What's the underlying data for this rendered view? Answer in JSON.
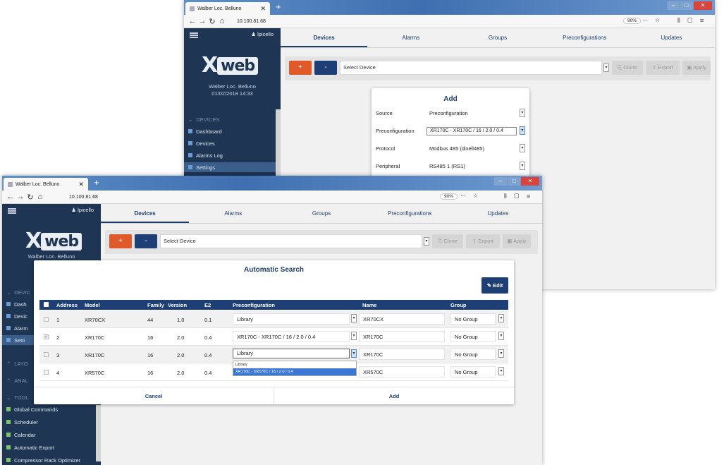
{
  "back_window": {
    "tab_title": "Walber Loc. Belluno",
    "url": "10.100.81.68",
    "zoom": "90%",
    "user": "lpicello",
    "logo": "web",
    "site_name": "Walber Loc. Belluno",
    "site_datetime": "01/02/2018 14:33",
    "sidebar_section": "DEVICES",
    "sidebar_items": [
      "Dashboard",
      "Devices",
      "Alarms Log",
      "Settings"
    ],
    "tabs": [
      "Devices",
      "Alarms",
      "Groups",
      "Preconfigurations",
      "Updates"
    ],
    "plus_label": "+",
    "minus_label": "-",
    "select_device": "Select Device",
    "clone_label": "Clone",
    "export_label": "Export",
    "apply_label": "Apply",
    "add_dialog": {
      "title": "Add",
      "rows": [
        {
          "label": "Source",
          "value": "Preconfiguration"
        },
        {
          "label": "Preconfiguration",
          "value": "XR170C - XR170C / 16 / 2.0 / 0.4"
        },
        {
          "label": "Protocol",
          "value": "Modbus 485 (dixell485)"
        },
        {
          "label": "Peripheral",
          "value": "RS485 1 (RS1)"
        }
      ]
    }
  },
  "front_window": {
    "tab_title": "Walber Loc. Belluno",
    "url": "10.100.81.68",
    "zoom": "90%",
    "user": "lpicello",
    "logo": "web",
    "site_name": "Walber Loc. Belluno",
    "sidebar_partial": [
      "DEVIC",
      "Dash",
      "Devic",
      "Alarm",
      "Setti",
      "LAYO",
      "ANAL",
      "TOOL"
    ],
    "sidebar_tools": [
      "Global Commands",
      "Scheduler",
      "Calendar",
      "Automatic Export",
      "Compressor Rack Optimizer"
    ],
    "tabs": [
      "Devices",
      "Alarms",
      "Groups",
      "Preconfigurations",
      "Updates"
    ],
    "plus_label": "+",
    "minus_label": "-",
    "select_device": "Select Device",
    "clone_label": "Clone",
    "export_label": "Export",
    "apply_label": "Apply"
  },
  "search_dialog": {
    "title": "Automatic Search",
    "edit_label": "Edit",
    "columns": [
      "Address",
      "Model",
      "Family",
      "Version",
      "E2",
      "Preconfiguration",
      "Name",
      "Group"
    ],
    "rows": [
      {
        "checked": false,
        "address": "1",
        "model": "XR70CX",
        "family": "44",
        "version": "1.0",
        "e2": "0.1",
        "preconfiguration": "Library",
        "name": "XR70CX",
        "group": "No Group"
      },
      {
        "checked": true,
        "address": "2",
        "model": "XR170C",
        "family": "16",
        "version": "2.0",
        "e2": "0.4",
        "preconfiguration": "XR170C - XR170C / 16 / 2.0 / 0.4",
        "name": "XR170C",
        "group": "No Group"
      },
      {
        "checked": false,
        "address": "3",
        "model": "XR170C",
        "family": "16",
        "version": "2.0",
        "e2": "0.4",
        "preconfiguration": "Library",
        "name": "XR170C",
        "group": "No Group"
      },
      {
        "checked": false,
        "address": "4",
        "model": "XR570C",
        "family": "16",
        "version": "2.0",
        "e2": "0.4",
        "preconfiguration": "",
        "name": "XR570C",
        "group": "No Group"
      }
    ],
    "dropdown_options": [
      "Library",
      "XR170C - XR170C / 16 / 2.0 / 0.4"
    ],
    "cancel_label": "Cancel",
    "add_label": "Add"
  }
}
